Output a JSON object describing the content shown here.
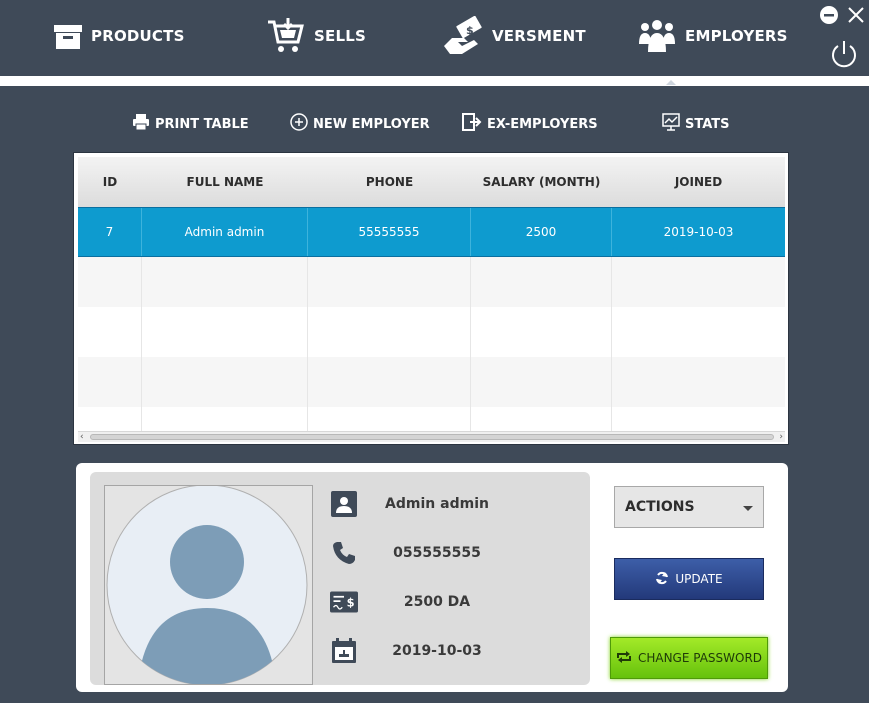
{
  "nav": {
    "items": [
      {
        "label": "PRODUCTS",
        "icon": "archive-box-icon"
      },
      {
        "label": "SELLS",
        "icon": "shopping-cart-icon"
      },
      {
        "label": "VERSMENT",
        "icon": "money-hand-icon"
      },
      {
        "label": "EMPLOYERS",
        "icon": "team-icon",
        "active": true
      }
    ]
  },
  "toolbar": {
    "print_label": "PRINT TABLE",
    "new_label": "NEW EMPLOYER",
    "ex_label": "EX-EMPLOYERS",
    "stats_label": "STATS"
  },
  "table": {
    "columns": [
      "ID",
      "FULL NAME",
      "PHONE",
      "SALARY (MONTH)",
      "JOINED"
    ],
    "rows": [
      {
        "id": "7",
        "name": "Admin admin",
        "phone": "55555555",
        "salary": "2500",
        "joined": "2019-10-03"
      }
    ]
  },
  "details": {
    "name": "Admin admin",
    "phone": "055555555",
    "salary": "2500 DA",
    "joined": "2019-10-03",
    "actions_label": "ACTIONS",
    "update_label": "UPDATE",
    "change_password_label": "CHANGE PASSWORD"
  },
  "colors": {
    "nav_bg": "#3f4a58",
    "selected_row": "#0e9bcf",
    "update_btn": "#2b4688",
    "change_pw_btn": "#86d61a"
  }
}
